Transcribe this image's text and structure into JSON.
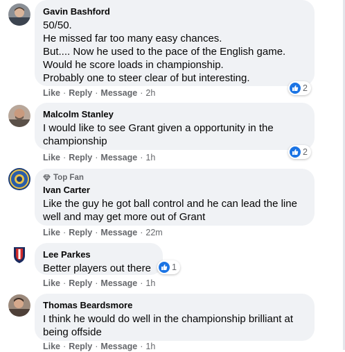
{
  "actions": {
    "like": "Like",
    "reply": "Reply",
    "message": "Message"
  },
  "comments": [
    {
      "author": "Gavin Bashford",
      "text": "50/50.\nHe missed far too many easy chances.\nBut.... Now he used to the pace of the English game.\nWould he score loads in championship.\nProbably one to steer clear of but interesting.",
      "time": "2h",
      "reactions": "2"
    },
    {
      "author": "Malcolm Stanley",
      "text": "I would like to see Grant given a opportunity in the championship",
      "time": "1h",
      "reactions": "2"
    },
    {
      "badge": "Top Fan",
      "author": "Ivan Carter",
      "text": "Like the guy he got ball control and he can lead the line well and may get more out of Grant",
      "time": "22m"
    },
    {
      "author": "Lee Parkes",
      "text": "Better players out there",
      "time": "1h",
      "reactions": "1"
    },
    {
      "author": "Thomas Beardsmore",
      "text": "I think he would do well in the championship brilliant at being offside",
      "time": "1h"
    }
  ],
  "colors": {
    "bubble": "#f0f2f5",
    "meta_gray": "#65676b",
    "like_blue": "#1b74e4",
    "text": "#050505"
  }
}
